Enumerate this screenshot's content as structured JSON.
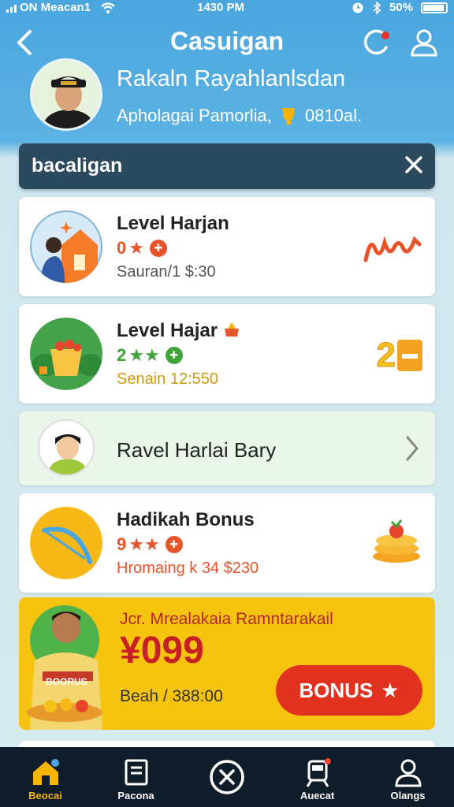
{
  "status_bar": {
    "carrier": "ON Meacan1",
    "time": "1430 PM",
    "battery": "50%"
  },
  "header": {
    "title": "Casuigan",
    "user_name": "Rakaln Rayahlanlsdan",
    "user_sub": "Apholagai Pamorlia,",
    "user_points": "0810al."
  },
  "banner": {
    "text": "bacaligan"
  },
  "cards": [
    {
      "title": "Level Harjan",
      "rating": "0",
      "sub": "Sauran/1 $:30",
      "accent": "#e8542a"
    },
    {
      "title": "Level Hajar",
      "rating": "2",
      "sub": "Senain 12:550",
      "side_text": "2",
      "accent": "#3fa33a"
    },
    {
      "title": "Ravel Harlai Bary"
    },
    {
      "title": "Hadikah Bonus",
      "rating": "9",
      "sub": "Hromaing k 34 $230",
      "accent": "#e8542a"
    }
  ],
  "promo": {
    "headline": "Jcr. Mrealakaia Ramntarakail",
    "amount": "¥099",
    "sub": "Beah / 388:00",
    "button": "BONUS",
    "shirt_text": "BOORUS"
  },
  "nav": [
    {
      "label": "Beocai",
      "icon": "home-icon"
    },
    {
      "label": "Pacona",
      "icon": "document-icon"
    },
    {
      "label": "",
      "icon": "close-circle-icon"
    },
    {
      "label": "Auecat",
      "icon": "train-icon"
    },
    {
      "label": "Olangs",
      "icon": "profile-icon"
    }
  ],
  "colors": {
    "header_blue": "#4aa6df",
    "banner": "#2c4a5e",
    "promo_yellow": "#f6c40f",
    "bonus_red": "#e0321f",
    "nav_bg": "#0f1c2a",
    "nav_active": "#f7b500"
  }
}
